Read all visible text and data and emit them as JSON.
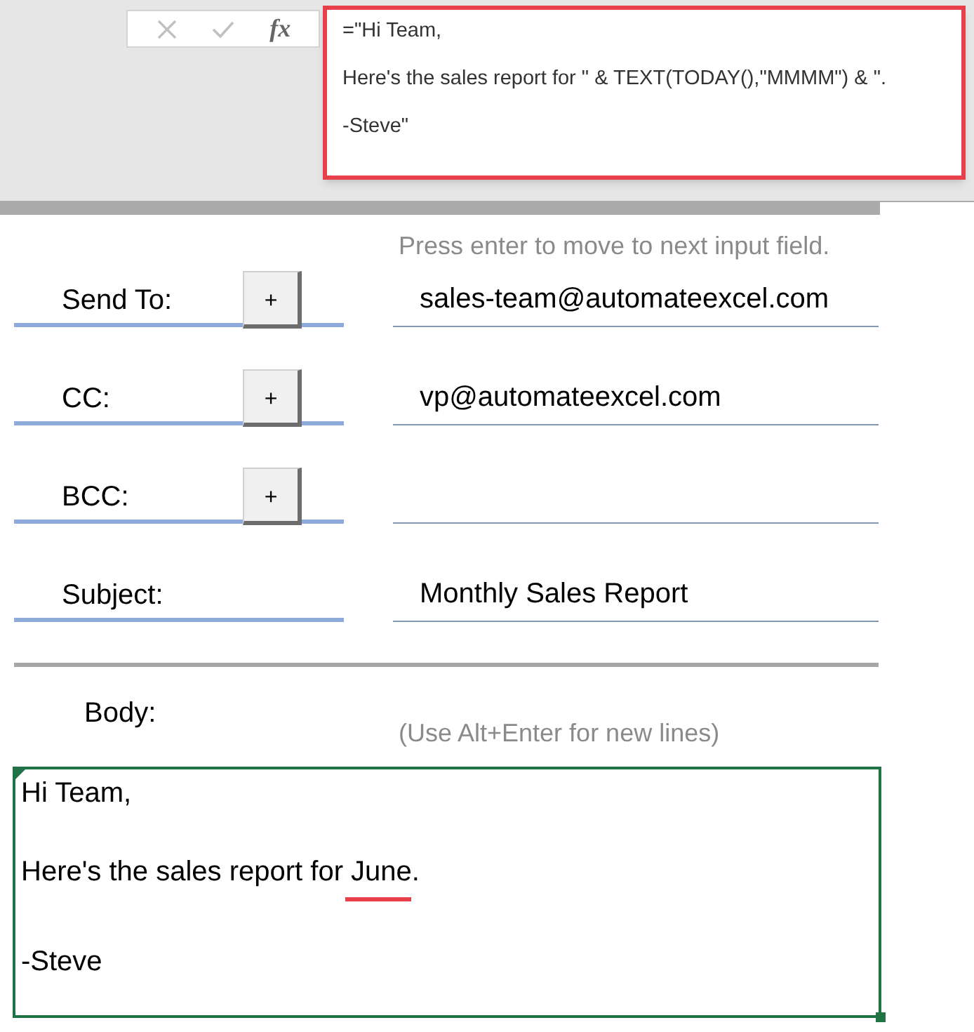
{
  "formula_bar": {
    "buttons": [
      {
        "kind": "cancel",
        "disabled": true
      },
      {
        "kind": "enter",
        "disabled": true
      },
      {
        "kind": "function",
        "disabled": false,
        "glyph": "fx"
      }
    ],
    "formula_lines": [
      "=\"Hi Team,",
      "Here's the sales report for \" & TEXT(TODAY(),\"MMMM\") & \".",
      "-Steve\""
    ]
  },
  "form": {
    "hint": "Press enter to move to next input field.",
    "fields": [
      {
        "label": "Send To:",
        "add_button": "+",
        "value": "sales-team@automateexcel.com"
      },
      {
        "label": "CC:",
        "add_button": "+",
        "value": "vp@automateexcel.com"
      },
      {
        "label": "BCC:",
        "add_button": "+"
      },
      {
        "label": "Subject:",
        "value": "Monthly Sales Report"
      }
    ],
    "body_label": "Body:",
    "body_hint": "(Use Alt+Enter for new lines)",
    "body_lines": [
      {
        "before": "Hi Team,"
      },
      {
        "before": "Here's the sales report for ",
        "underlined": "June",
        "after": "."
      },
      {
        "before": "-Steve"
      }
    ]
  }
}
